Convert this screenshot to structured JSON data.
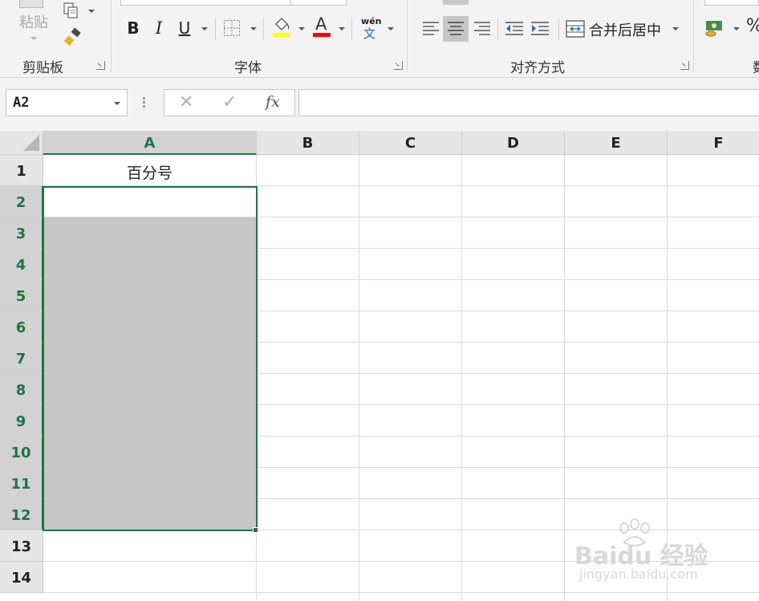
{
  "ribbon": {
    "clipboard": {
      "paste_label": "粘贴",
      "group_label": "剪贴板"
    },
    "font": {
      "group_label": "字体",
      "bold_label": "B",
      "italic_label": "I",
      "underline_label": "U",
      "font_color_label": "A",
      "phonetic_top": "wén",
      "phonetic_bottom": "文",
      "fill_color": "#ffff00",
      "font_color": "#ff0000"
    },
    "alignment": {
      "group_label": "对齐方式",
      "merge_label": "合并后居中"
    },
    "number": {
      "percent_label": "%",
      "group_label_partial": "数"
    }
  },
  "formula_bar": {
    "name_box_value": "A2",
    "cancel_symbol": "✕",
    "enter_symbol": "✓",
    "fx_label": "fx",
    "formula_value": ""
  },
  "sheet": {
    "columns": [
      "A",
      "B",
      "C",
      "D",
      "E",
      "F"
    ],
    "rows": [
      "1",
      "2",
      "3",
      "4",
      "5",
      "6",
      "7",
      "8",
      "9",
      "10",
      "11",
      "12",
      "13",
      "14"
    ],
    "selected_column": "A",
    "selected_rows": [
      "2",
      "3",
      "4",
      "5",
      "6",
      "7",
      "8",
      "9",
      "10",
      "11",
      "12"
    ],
    "cells": {
      "A1": "百分号"
    },
    "accent_color": "#217346"
  },
  "watermark": {
    "main": "Baidu 经验",
    "sub": "jingyan.baidu.com"
  }
}
